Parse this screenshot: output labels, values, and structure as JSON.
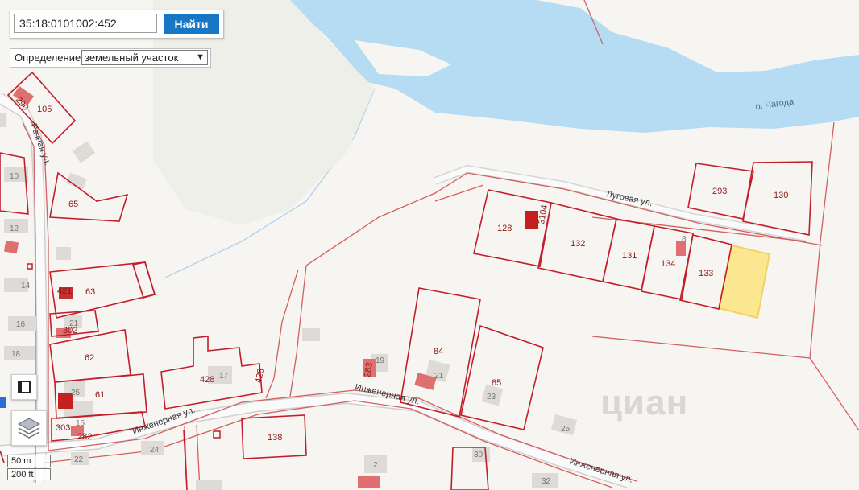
{
  "search": {
    "value": "35:18:0101002:452",
    "button_label": "Найти"
  },
  "definition": {
    "label": "Определение:",
    "selected": "земельный участок"
  },
  "scale": {
    "metric": "50 m",
    "imperial": "200 ft"
  },
  "watermark": "циан",
  "map": {
    "river_label": "р. Чагода",
    "streets": {
      "lugovaya": "Луговая ул.",
      "inzhenernaya": "Инженерная ул.",
      "rechnaya": "Речная ул."
    },
    "parcels": [
      "105",
      "290",
      "65",
      "63",
      "421",
      "302",
      "62",
      "61",
      "303",
      "282",
      "428",
      "428",
      "138",
      "84",
      "85",
      "283",
      "128",
      "3104",
      "132",
      "131",
      "134",
      "133",
      "293",
      "130"
    ],
    "house_numbers": [
      "10",
      "12",
      "14",
      "16",
      "18",
      "21",
      "25",
      "15",
      "17",
      "19",
      "21",
      "23",
      "25",
      "22",
      "24",
      "2",
      "32",
      "30",
      "8"
    ]
  },
  "colors": {
    "parcel_border": "#c41d2a",
    "road": "#d26060",
    "water": "#b6dcf3",
    "selected_parcel": "#fbe78f",
    "button": "#1877c4"
  }
}
